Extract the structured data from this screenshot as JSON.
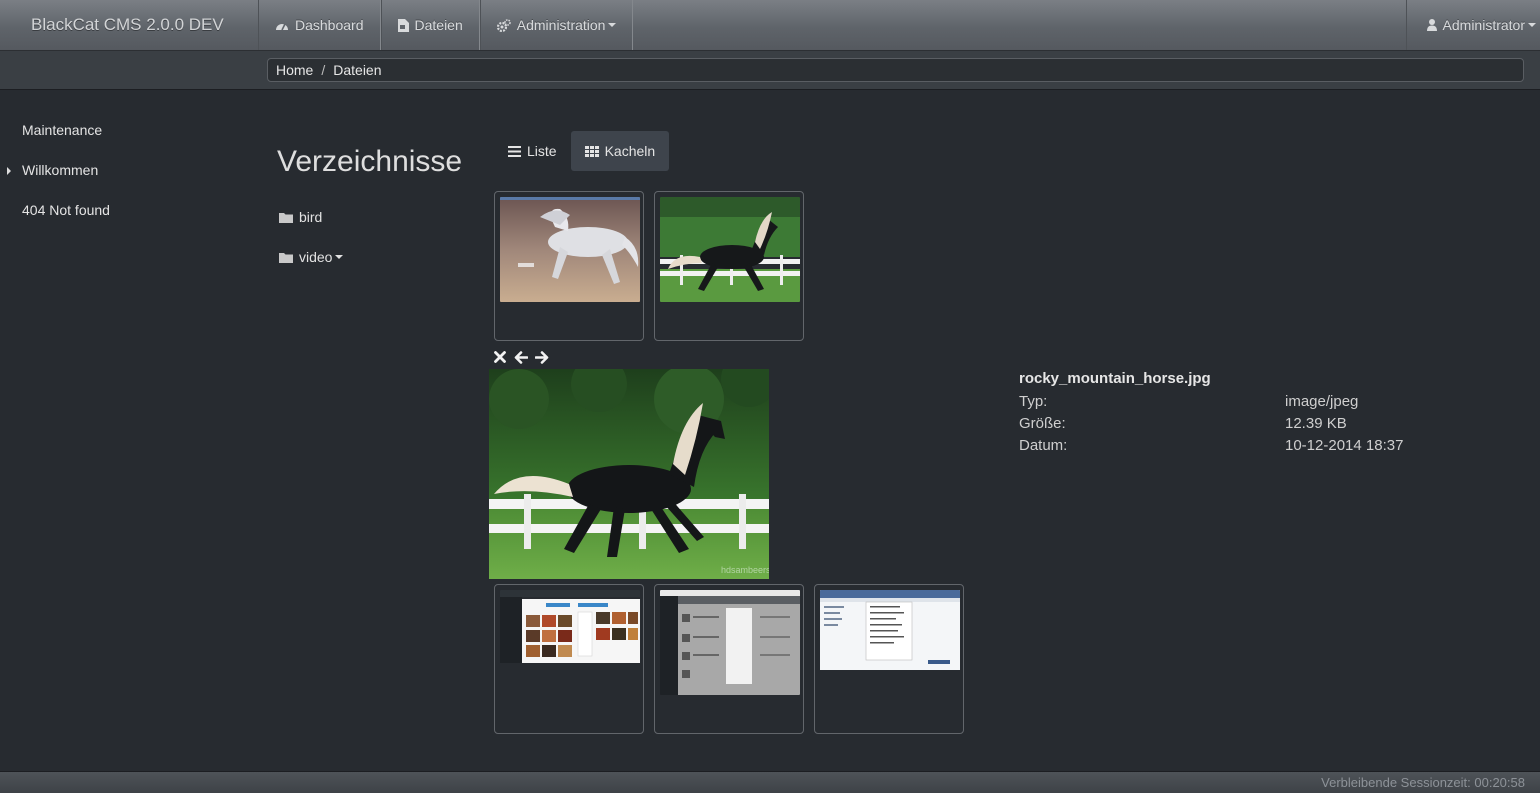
{
  "navbar": {
    "brand": "BlackCat CMS 2.0.0 DEV",
    "items": [
      {
        "label": "Dashboard",
        "icon": "dashboard-icon"
      },
      {
        "label": "Dateien",
        "icon": "file-icon"
      },
      {
        "label": "Administration",
        "icon": "cogs-icon",
        "dropdown": true
      }
    ],
    "user": {
      "label": "Administrator",
      "icon": "user-icon",
      "dropdown": true
    }
  },
  "breadcrumb": [
    "Home",
    "Dateien"
  ],
  "sidebar": {
    "items": [
      {
        "label": "Maintenance"
      },
      {
        "label": "Willkommen",
        "expandable": true
      },
      {
        "label": "404 Not found"
      }
    ]
  },
  "directories": {
    "title": "Verzeichnisse",
    "items": [
      {
        "label": "bird",
        "icon": "folder-icon"
      },
      {
        "label": "video",
        "icon": "folder-icon",
        "dropdown": true
      }
    ]
  },
  "view_toggle": {
    "list_label": "Liste",
    "tiles_label": "Kacheln",
    "active": "tiles"
  },
  "tiles": [
    {
      "kind": "horse-white"
    },
    {
      "kind": "horse-black"
    },
    {
      "kind": "screenshot-light"
    },
    {
      "kind": "screenshot-dark"
    },
    {
      "kind": "screenshot-blue"
    }
  ],
  "preview": {
    "controls": [
      "close-icon",
      "arrow-left-icon",
      "arrow-right-icon"
    ],
    "watermark": "hdsambeers"
  },
  "file_info": {
    "name": "rocky_mountain_horse.jpg",
    "rows": [
      {
        "key": "Typ:",
        "value": "image/jpeg"
      },
      {
        "key": "Größe:",
        "value": "12.39 KB"
      },
      {
        "key": "Datum:",
        "value": "10-12-2014 18:37"
      }
    ]
  },
  "footer": {
    "session_text": "Verbleibende Sessionzeit: 00:20:58"
  },
  "colors": {
    "background": "#272b30",
    "navbar": "#5f646a",
    "tile_border": "#62666b"
  }
}
